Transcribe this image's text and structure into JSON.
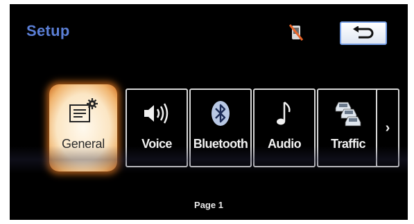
{
  "header": {
    "title": "Setup"
  },
  "menu": {
    "items": [
      {
        "label": "General",
        "icon": "general-settings-icon",
        "selected": true
      },
      {
        "label": "Voice",
        "icon": "speaker-icon",
        "selected": false
      },
      {
        "label": "Bluetooth",
        "icon": "bluetooth-icon",
        "selected": false
      },
      {
        "label": "Audio",
        "icon": "music-note-icon",
        "selected": false
      },
      {
        "label": "Traffic",
        "icon": "traffic-cars-icon",
        "selected": false
      }
    ],
    "more_icon": "chevron-right-icon"
  },
  "footer": {
    "page_label": "Page 1"
  },
  "colors": {
    "title": "#5b7fd6",
    "back_button_border": "#7aa2e8",
    "selected_glow": "#cf6d1e",
    "mute_slash": "#e8652a"
  }
}
